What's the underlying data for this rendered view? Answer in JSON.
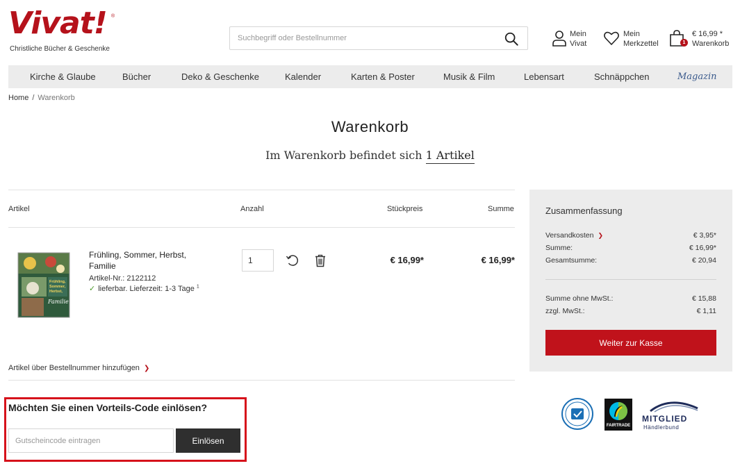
{
  "header": {
    "logo_text": "Vivat!",
    "logo_tagline": "Christliche Bücher & Geschenke",
    "search_placeholder": "Suchbegriff oder Bestellnummer",
    "account_line1": "Mein",
    "account_line2": "Vivat",
    "wishlist_line1": "Mein",
    "wishlist_line2": "Merkzettel",
    "cart_total": "€ 16,99 *",
    "cart_label": "Warenkorb",
    "cart_count": "1"
  },
  "nav": {
    "items": [
      {
        "label": "Kirche & Glaube"
      },
      {
        "label": "Bücher"
      },
      {
        "label": "Deko & Geschenke"
      },
      {
        "label": "Kalender"
      },
      {
        "label": "Karten & Poster"
      },
      {
        "label": "Musik & Film"
      },
      {
        "label": "Lebensart"
      },
      {
        "label": "Schnäppchen"
      },
      {
        "label": "Magazin"
      }
    ]
  },
  "breadcrumb": {
    "home": "Home",
    "separator": "/",
    "current": "Warenkorb"
  },
  "page": {
    "title": "Warenkorb",
    "subtitle_prefix": "Im Warenkorb befindet sich",
    "subtitle_count": "1 Artikel"
  },
  "table": {
    "col_article": "Artikel",
    "col_qty": "Anzahl",
    "col_unit_price": "Stückpreis",
    "col_sum": "Summe"
  },
  "item": {
    "name": "Frühling, Sommer, Herbst, Familie",
    "sku": "Artikel-Nr.: 2122112",
    "availability": "lieferbar. Lieferzeit: 1-3 Tage",
    "availability_footnote": "1",
    "quantity": "1",
    "unit_price": "€ 16,99*",
    "sum": "€ 16,99*",
    "cover_title_lines": [
      "Frühling,",
      "Sommer,",
      "Herbst,",
      "Familie"
    ]
  },
  "add_by_number": "Artikel über Bestellnummer hinzufügen",
  "voucher": {
    "title": "Möchten Sie einen Vorteils-Code einlösen?",
    "placeholder": "Gutscheincode eintragen",
    "button": "Einlösen"
  },
  "summary": {
    "title": "Zusammenfassung",
    "shipping_label": "Versandkosten",
    "shipping_value": "€ 3,95*",
    "subtotal_label": "Summe:",
    "subtotal_value": "€ 16,99*",
    "total_label": "Gesamtsumme:",
    "total_value": "€ 20,94",
    "net_label": "Summe ohne MwSt.:",
    "net_value": "€ 15,88",
    "vat_label": "zzgl. MwSt.:",
    "vat_value": "€ 1,11",
    "checkout_button": "Weiter zur Kasse"
  },
  "badges": {
    "fairtrade": "FAIRTRADE",
    "member_line1": "MITGLIED",
    "member_line2": "Händlerbund"
  },
  "colors": {
    "brand_red": "#b5121b",
    "nav_bg": "#ececec",
    "highlight_border": "#d6121b"
  }
}
